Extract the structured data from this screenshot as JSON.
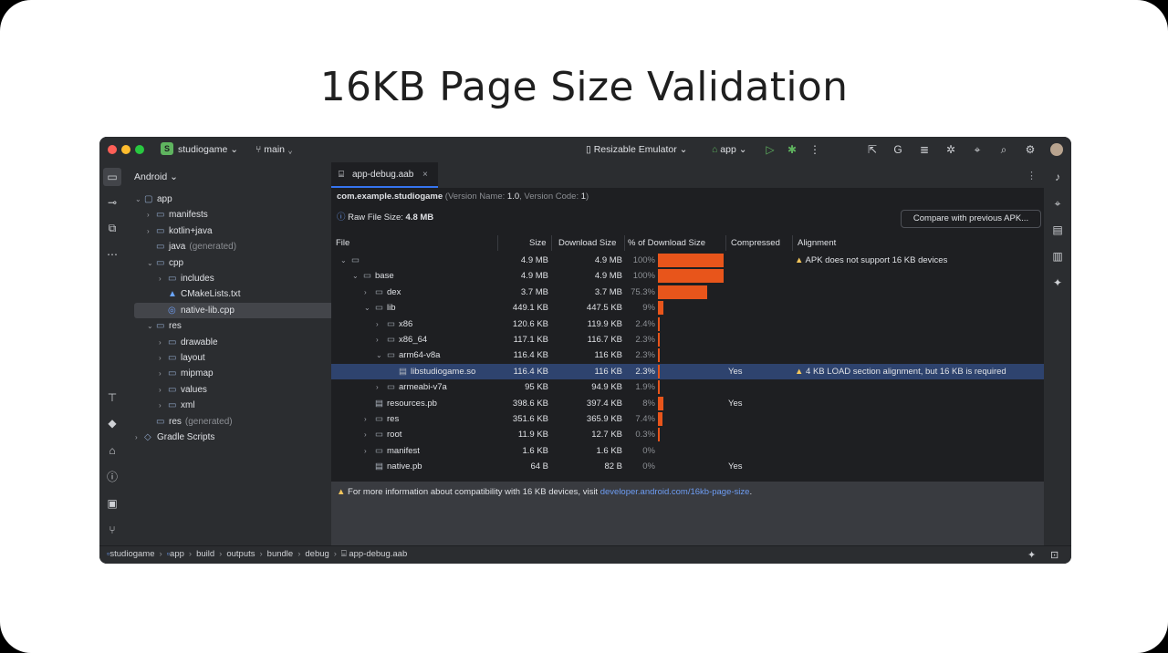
{
  "slide": {
    "title": "16KB Page Size Validation"
  },
  "colors": {
    "traffic_red": "#fe5f57",
    "traffic_yellow": "#febc2e",
    "traffic_green": "#28c840",
    "accent": "#3574f0",
    "bar": "#e8551b",
    "selection": "#2e436e",
    "warning": "#f2c55c"
  },
  "titlebar": {
    "project_initial": "S",
    "project_name": "studiogame",
    "branch_name": "main",
    "device": "Resizable Emulator",
    "run_config": "app",
    "icons": [
      "gradle-sync-icon",
      "translate-icon",
      "logcat-icon",
      "debug-icon",
      "device-manager-icon",
      "search-icon",
      "settings-icon",
      "avatar"
    ]
  },
  "project": {
    "view_label": "Android",
    "tree": [
      {
        "label": "app",
        "chev": "⌄",
        "icon": "▢"
      },
      {
        "label": "manifests",
        "chev": "›",
        "icon": "▭"
      },
      {
        "label": "kotlin+java",
        "chev": "›",
        "icon": "▭"
      },
      {
        "label": "java",
        "suffix": "(generated)",
        "chev": "",
        "icon": "▭"
      },
      {
        "label": "cpp",
        "chev": "⌄",
        "icon": "▭"
      },
      {
        "label": "includes",
        "chev": "›",
        "icon": "▭"
      },
      {
        "label": "CMakeLists.txt",
        "chev": "",
        "icon": "▲"
      },
      {
        "label": "native-lib.cpp",
        "chev": "",
        "icon": "◎",
        "selected": true
      },
      {
        "label": "res",
        "chev": "⌄",
        "icon": "▭"
      },
      {
        "label": "drawable",
        "chev": "›",
        "icon": "▭"
      },
      {
        "label": "layout",
        "chev": "›",
        "icon": "▭"
      },
      {
        "label": "mipmap",
        "chev": "›",
        "icon": "▭"
      },
      {
        "label": "values",
        "chev": "›",
        "icon": "▭"
      },
      {
        "label": "xml",
        "chev": "›",
        "icon": "▭"
      },
      {
        "label": "res",
        "suffix": "(generated)",
        "chev": "",
        "icon": "▭"
      },
      {
        "label": "Gradle Scripts",
        "chev": "›",
        "icon": "◇"
      }
    ]
  },
  "editor": {
    "tab_label": "app-debug.aab",
    "package": "com.example.studiogame",
    "version_name_label": "(Version Name: ",
    "version_name": "1.0",
    "version_code_label": ", Version Code: ",
    "version_code": "1",
    "version_close": ")",
    "raw_size_label": "Raw File Size: ",
    "raw_size": "4.8 MB",
    "compare_button": "Compare with previous APK...",
    "columns": [
      "File",
      "Size",
      "Download Size",
      "% of Download Size",
      "Compressed",
      "Alignment"
    ],
    "rows": [
      {
        "name": "",
        "chev": "⌄",
        "icon": "▭",
        "size": "4.9 MB",
        "dl": "4.9 MB",
        "pct": "100%",
        "pct_value": 100,
        "comp": "",
        "align": "APK does not support 16 KB devices",
        "warn": true
      },
      {
        "name": "base",
        "chev": "⌄",
        "icon": "▭",
        "size": "4.9 MB",
        "dl": "4.9 MB",
        "pct": "100%",
        "pct_value": 100,
        "comp": "",
        "align": ""
      },
      {
        "name": "dex",
        "chev": "›",
        "icon": "▭",
        "size": "3.7 MB",
        "dl": "3.7 MB",
        "pct": "75.3%",
        "pct_value": 75.3,
        "comp": "",
        "align": ""
      },
      {
        "name": "lib",
        "chev": "⌄",
        "icon": "▭",
        "size": "449.1 KB",
        "dl": "447.5 KB",
        "pct": "9%",
        "pct_value": 9,
        "comp": "",
        "align": ""
      },
      {
        "name": "x86",
        "chev": "›",
        "icon": "▭",
        "size": "120.6 KB",
        "dl": "119.9 KB",
        "pct": "2.4%",
        "pct_value": 2.4,
        "comp": "",
        "align": ""
      },
      {
        "name": "x86_64",
        "chev": "›",
        "icon": "▭",
        "size": "117.1 KB",
        "dl": "116.7 KB",
        "pct": "2.3%",
        "pct_value": 2.3,
        "comp": "",
        "align": ""
      },
      {
        "name": "arm64-v8a",
        "chev": "⌄",
        "icon": "▭",
        "size": "116.4 KB",
        "dl": "116 KB",
        "pct": "2.3%",
        "pct_value": 2.3,
        "comp": "",
        "align": ""
      },
      {
        "name": "libstudiogame.so",
        "chev": "",
        "icon": "▤",
        "size": "116.4 KB",
        "dl": "116 KB",
        "pct": "2.3%",
        "pct_value": 2.3,
        "comp": "Yes",
        "align": "4 KB LOAD section alignment, but 16 KB is required",
        "warn": true,
        "selected": true
      },
      {
        "name": "armeabi-v7a",
        "chev": "›",
        "icon": "▭",
        "size": "95 KB",
        "dl": "94.9 KB",
        "pct": "1.9%",
        "pct_value": 1.9,
        "comp": "",
        "align": ""
      },
      {
        "name": "resources.pb",
        "chev": "",
        "icon": "▤",
        "size": "398.6 KB",
        "dl": "397.4 KB",
        "pct": "8%",
        "pct_value": 8,
        "comp": "Yes",
        "align": ""
      },
      {
        "name": "res",
        "chev": "›",
        "icon": "▭",
        "size": "351.6 KB",
        "dl": "365.9 KB",
        "pct": "7.4%",
        "pct_value": 7.4,
        "comp": "",
        "align": ""
      },
      {
        "name": "root",
        "chev": "›",
        "icon": "▭",
        "size": "11.9 KB",
        "dl": "12.7 KB",
        "pct": "0.3%",
        "pct_value": 0.3,
        "comp": "",
        "align": ""
      },
      {
        "name": "manifest",
        "chev": "›",
        "icon": "▭",
        "size": "1.6 KB",
        "dl": "1.6 KB",
        "pct": "0%",
        "pct_value": 0,
        "comp": "",
        "align": ""
      },
      {
        "name": "native.pb",
        "chev": "",
        "icon": "▤",
        "size": "64 B",
        "dl": "82 B",
        "pct": "0%",
        "pct_value": 0,
        "comp": "Yes",
        "align": ""
      }
    ],
    "footer_prefix": "For more information about compatibility with 16 KB devices, visit ",
    "footer_link": "developer.android.com/16kb-page-size",
    "footer_suffix": "."
  },
  "statusbar": {
    "crumbs": [
      "studiogame",
      "app",
      "build",
      "outputs",
      "bundle",
      "debug",
      "app-debug.aab"
    ]
  }
}
